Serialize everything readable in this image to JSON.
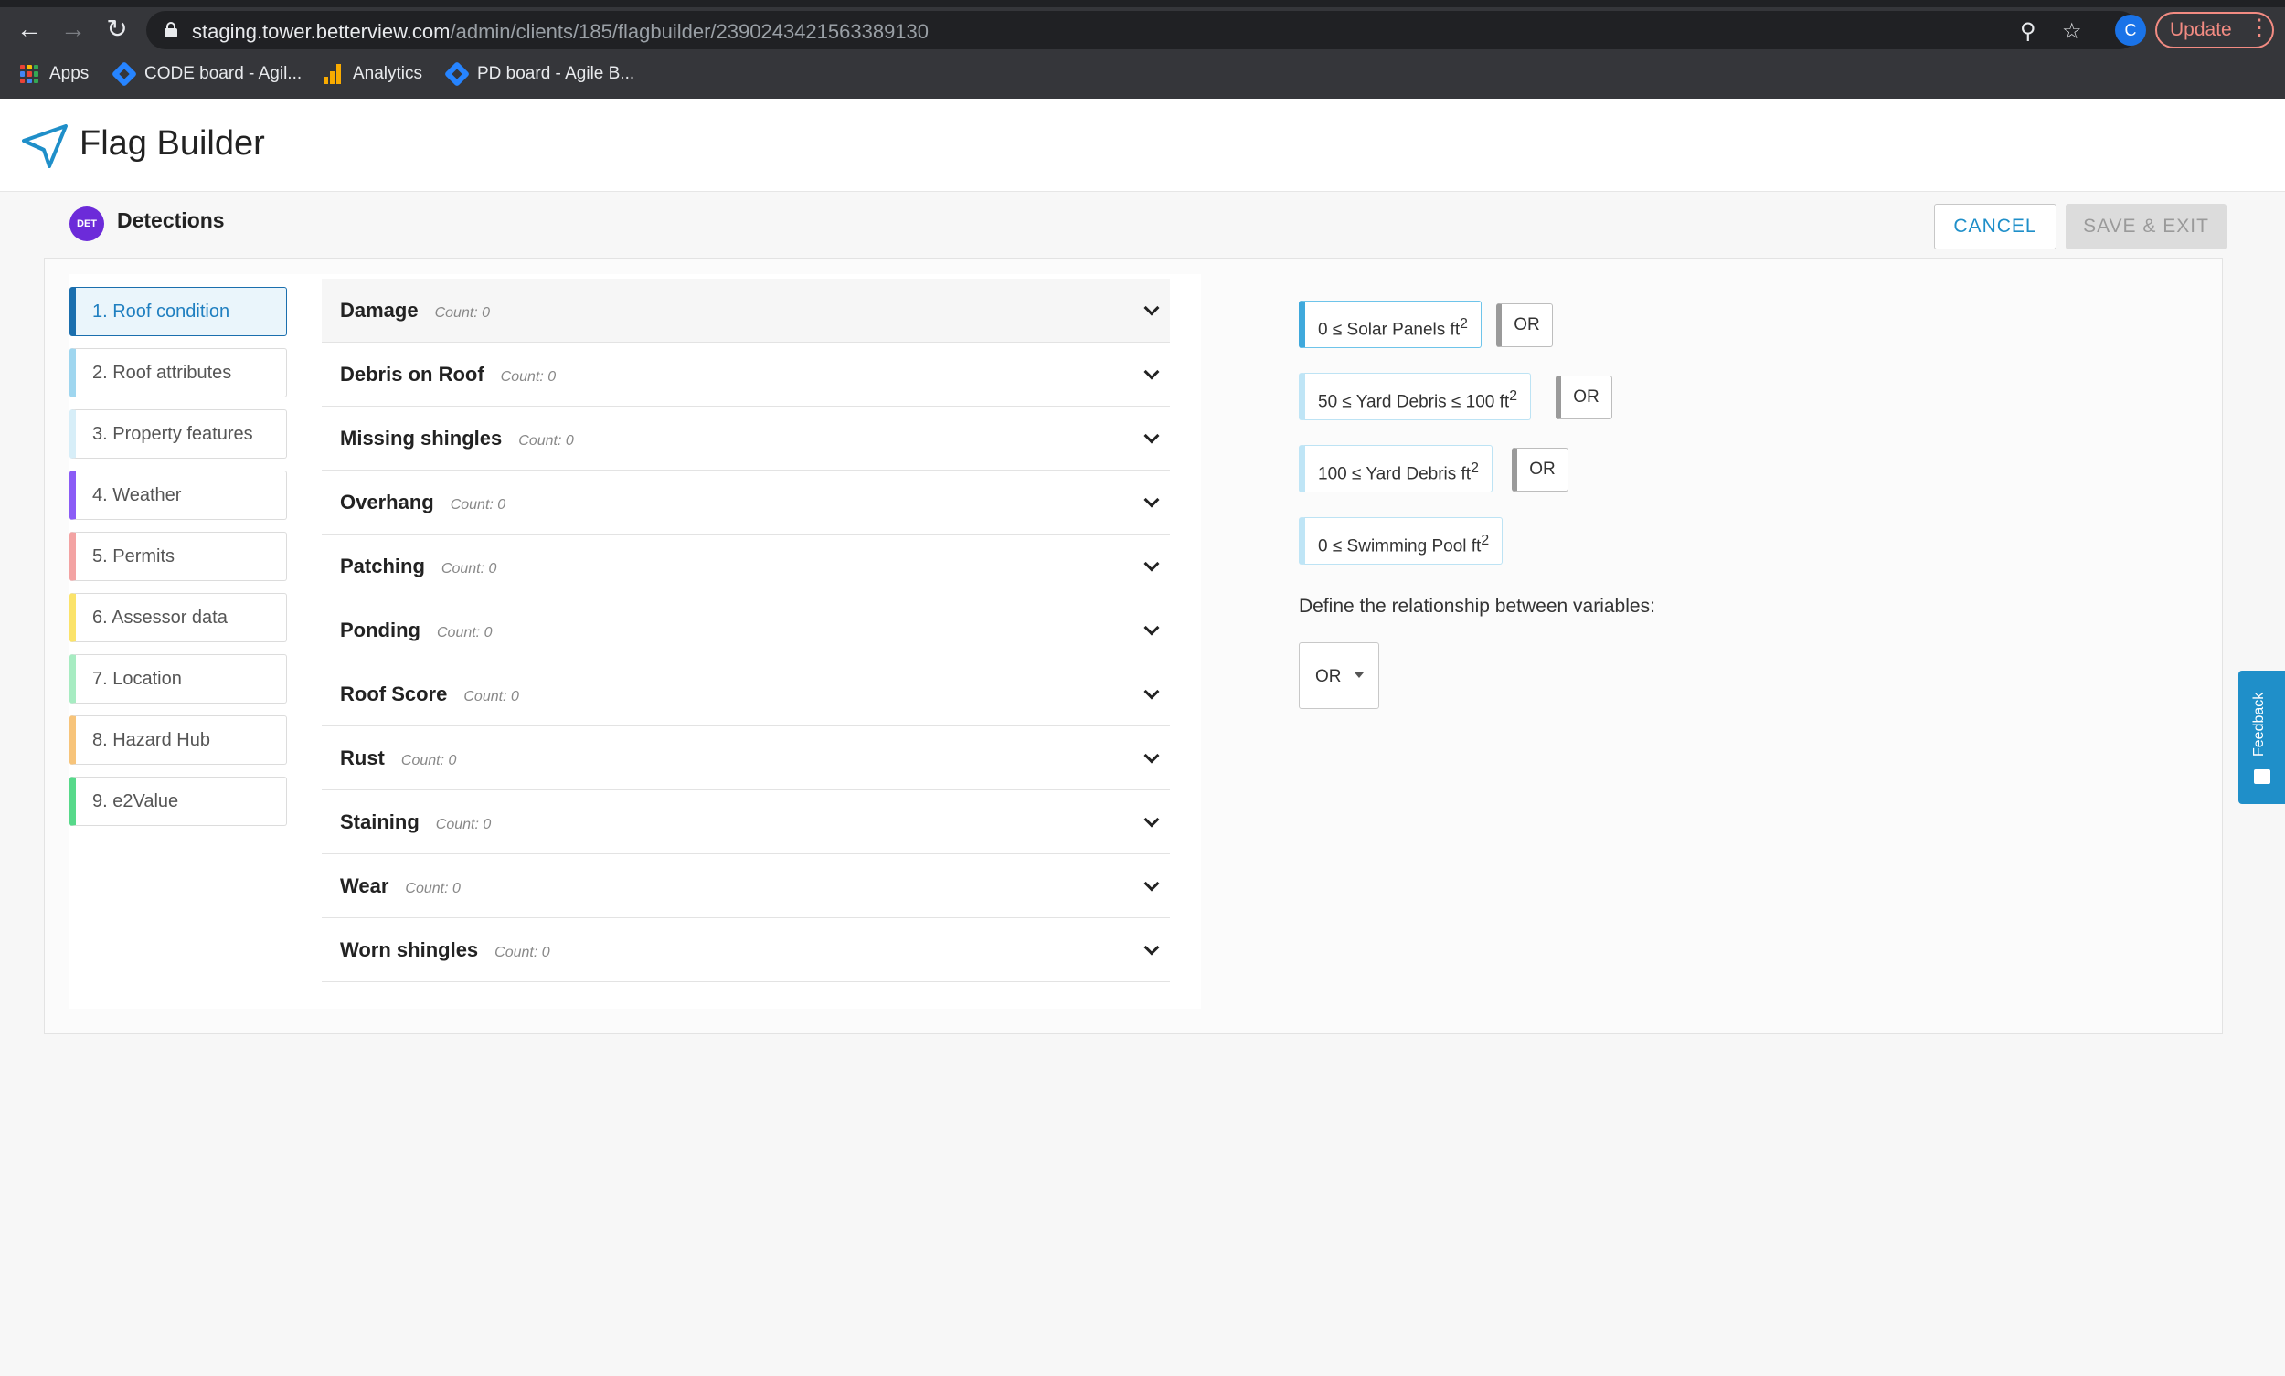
{
  "browser": {
    "url_host": "staging.tower.betterview.com",
    "url_path": "/admin/clients/185/flagbuilder/2390243421563389130",
    "profile_initial": "C",
    "update_label": "Update",
    "bookmarks": [
      "Apps",
      "CODE board - Agil...",
      "Analytics",
      "PD board - Agile B..."
    ]
  },
  "app": {
    "title": "Flag Builder"
  },
  "section": {
    "badge": "DET",
    "title": "Detections",
    "cancel_label": "CANCEL",
    "save_label": "SAVE & EXIT"
  },
  "categories": [
    {
      "label": "1. Roof condition",
      "color": "#1b6fae"
    },
    {
      "label": "2. Roof attributes",
      "color": "#9fd6ef"
    },
    {
      "label": "3. Property features",
      "color": "#d7eef8"
    },
    {
      "label": "4. Weather",
      "color": "#8b5cf6"
    },
    {
      "label": "5. Permits",
      "color": "#f3a3a3"
    },
    {
      "label": "6. Assessor data",
      "color": "#fbe36a"
    },
    {
      "label": "7. Location",
      "color": "#a7ecc2"
    },
    {
      "label": "8. Hazard Hub",
      "color": "#f7c47a"
    },
    {
      "label": "9. e2Value",
      "color": "#57d98a"
    }
  ],
  "detections": [
    {
      "name": "Damage",
      "count": "Count: 0"
    },
    {
      "name": "Debris on Roof",
      "count": "Count: 0"
    },
    {
      "name": "Missing shingles",
      "count": "Count: 0"
    },
    {
      "name": "Overhang",
      "count": "Count: 0"
    },
    {
      "name": "Patching",
      "count": "Count: 0"
    },
    {
      "name": "Ponding",
      "count": "Count: 0"
    },
    {
      "name": "Roof Score",
      "count": "Count: 0"
    },
    {
      "name": "Rust",
      "count": "Count: 0"
    },
    {
      "name": "Staining",
      "count": "Count: 0"
    },
    {
      "name": "Wear",
      "count": "Count: 0"
    },
    {
      "name": "Worn shingles",
      "count": "Count: 0"
    }
  ],
  "variables": [
    {
      "expr": "0 ≤ Solar Panels ft",
      "sup": "2",
      "connector": "OR"
    },
    {
      "expr": "50 ≤ Yard Debris ≤ 100 ft",
      "sup": "2",
      "connector": "OR"
    },
    {
      "expr": "100 ≤ Yard Debris ft",
      "sup": "2",
      "connector": "OR"
    },
    {
      "expr": "0 ≤ Swimming Pool ft",
      "sup": "2"
    }
  ],
  "relationship": {
    "label": "Define the relationship between variables:",
    "value": "OR"
  },
  "feedback_label": "Feedback"
}
